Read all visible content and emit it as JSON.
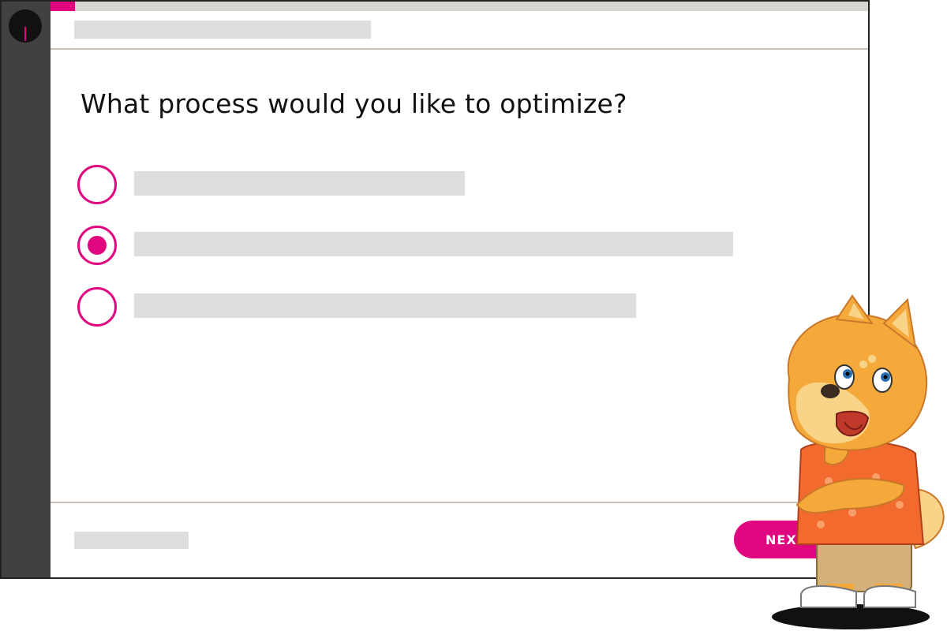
{
  "progress": {
    "fraction": 0.03
  },
  "question": {
    "text": "What process would you like to optimize?"
  },
  "options": [
    {
      "selected": false
    },
    {
      "selected": true
    },
    {
      "selected": false
    }
  ],
  "footer": {
    "next_label": "NEXT →"
  },
  "colors": {
    "accent": "#e0067f",
    "sidebar": "#414141",
    "placeholder": "#dedede"
  },
  "mascot": {
    "icon": "shiba-dog-mascot-icon"
  }
}
